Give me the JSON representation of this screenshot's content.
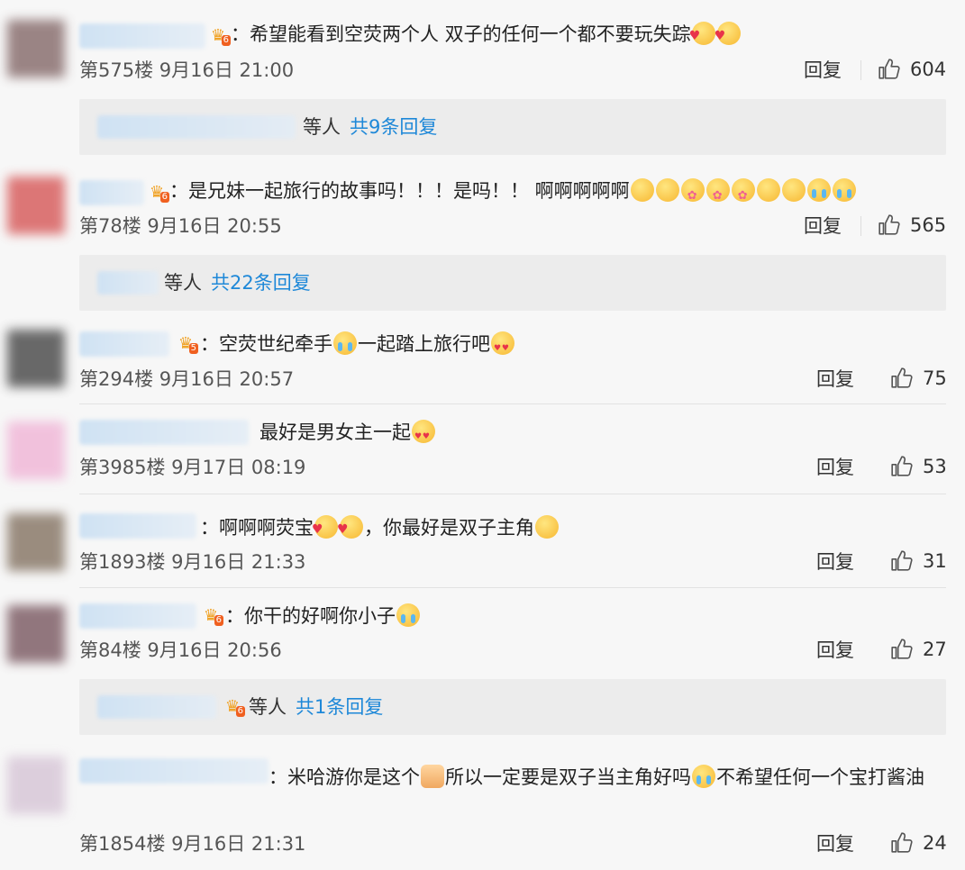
{
  "comments": [
    {
      "text_a": "：希望能看到空荧两个人 双子的任何一个都不要玩失踪",
      "floor": "第575楼",
      "date": "9月16日 21:00",
      "reply": "回复",
      "likes": "604",
      "badge_lv": "6"
    },
    {
      "text_a": "：是兄妹一起旅行的故事吗！！！是吗！！ 啊啊啊啊啊",
      "floor": "第78楼",
      "date": "9月16日 20:55",
      "reply": "回复",
      "likes": "565",
      "badge_lv": "6"
    },
    {
      "text_a": "：空荧世纪牵手",
      "text_b": "一起踏上旅行吧",
      "floor": "第294楼",
      "date": "9月16日 20:57",
      "reply": "回复",
      "likes": "75",
      "badge_lv": "5"
    },
    {
      "text_a": "最好是男女主一起",
      "floor": "第3985楼",
      "date": "9月17日 08:19",
      "reply": "回复",
      "likes": "53"
    },
    {
      "text_a": "：啊啊啊荧宝",
      "text_b": "，你最好是双子主角",
      "floor": "第1893楼",
      "date": "9月16日 21:33",
      "reply": "回复",
      "likes": "31"
    },
    {
      "text_a": "：你干的好啊你小子",
      "floor": "第84楼",
      "date": "9月16日 20:56",
      "reply": "回复",
      "likes": "27",
      "badge_lv": "6"
    },
    {
      "text_a": "：米哈游你是这个",
      "text_b": "所以一定要是双子当主角好吗",
      "text_c": "不希望任何一个宝打酱油",
      "floor": "第1854楼",
      "date": "9月16日 21:31",
      "reply": "回复",
      "likes": "24"
    }
  ],
  "reply_boxes": [
    {
      "etc": "等人",
      "more": "共9条回复"
    },
    {
      "etc": "等人",
      "more": "共22条回复"
    },
    {
      "etc": "等人",
      "more": "共1条回复",
      "badge_lv": "6"
    }
  ]
}
